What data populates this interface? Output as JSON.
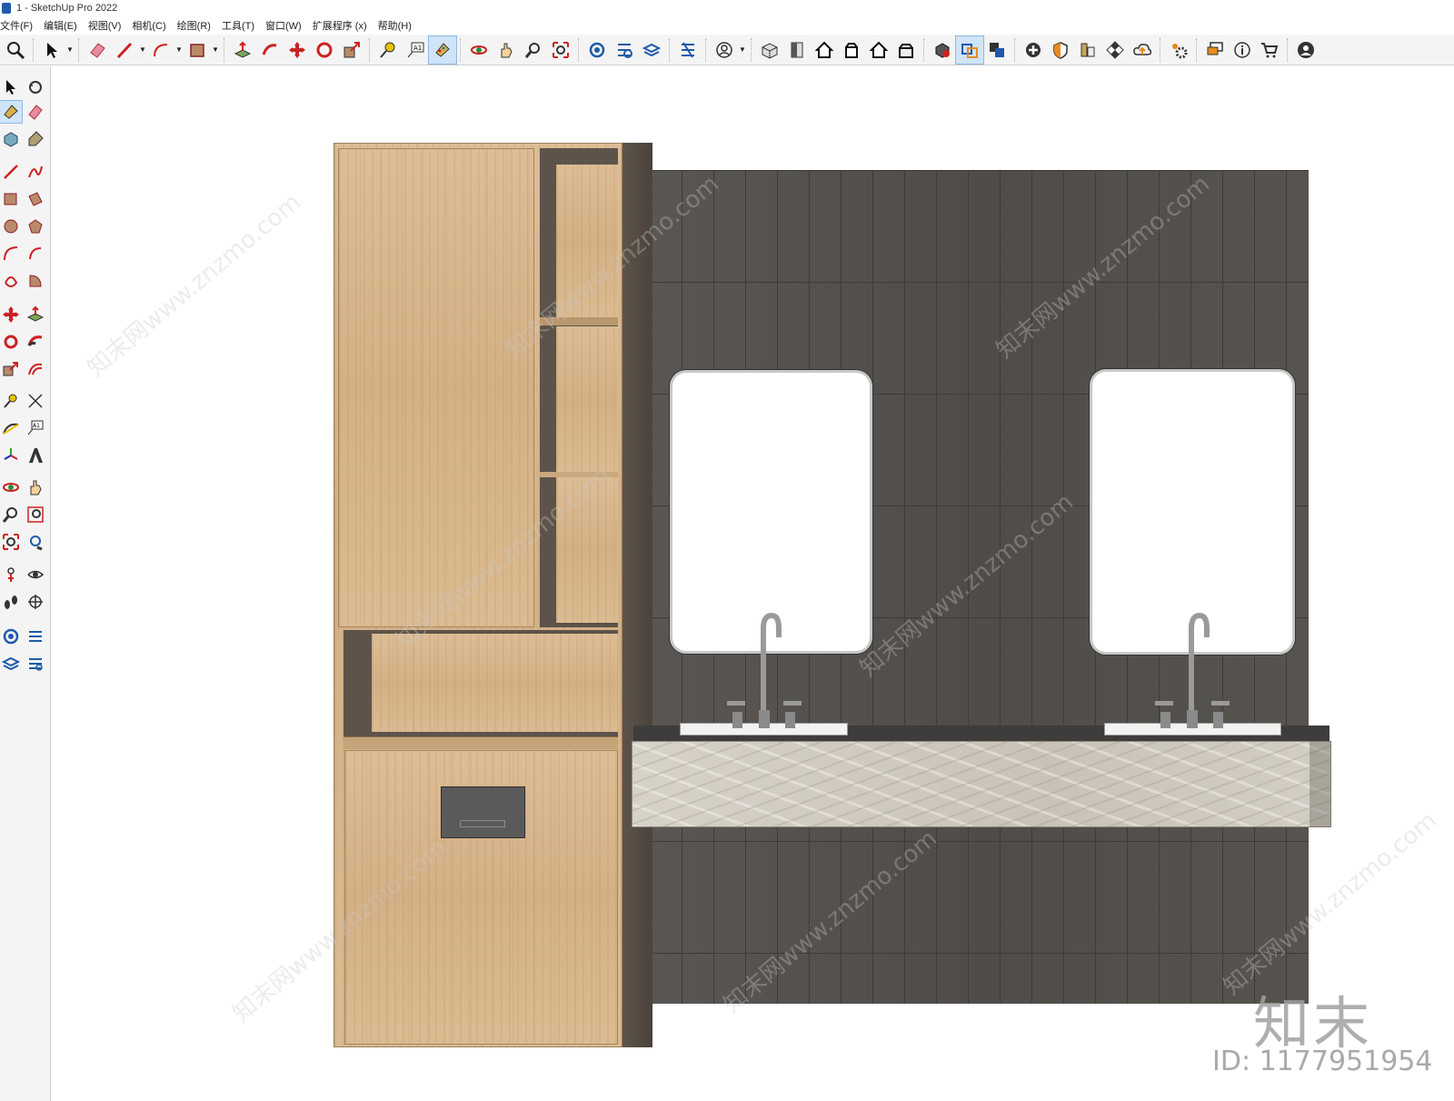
{
  "window": {
    "title": "1 - SketchUp Pro 2022"
  },
  "menu": [
    "文件(F)",
    "编辑(E)",
    "视图(V)",
    "相机(C)",
    "绘图(R)",
    "工具(T)",
    "窗口(W)",
    "扩展程序 (x)",
    "帮助(H)"
  ],
  "toolbar": {
    "icons": [
      "zoom-icon",
      "select-icon",
      "eraser-icon",
      "pencil-icon",
      "arc-icon",
      "rectangle-icon",
      "pushpull-icon",
      "followme-icon",
      "move-icon",
      "rotate-icon",
      "scale-icon",
      "tape-icon",
      "text-icon",
      "paint-icon",
      "orbit-icon",
      "pan-icon",
      "zoom-window-icon",
      "zoom-extents-icon",
      "warehouse-icon",
      "extension-icon",
      "layers-icon",
      "styles-icon",
      "profile-icon",
      "iso-view-icon",
      "top-view-icon",
      "front-view-icon",
      "right-view-icon",
      "back-view-icon",
      "left-view-icon",
      "solid-icon",
      "union-icon",
      "subtract-icon",
      "add-location-icon",
      "shadow-icon",
      "materials-icon",
      "checker-icon",
      "cloud-icon",
      "settings-icon",
      "chat-icon",
      "info-icon",
      "cart-icon",
      "account-icon"
    ],
    "active": "paint-icon"
  },
  "left_toolbar": {
    "icons": [
      "select-icon",
      "orbit-icon",
      "paint-icon",
      "eraser-icon",
      "component-icon",
      "tag-icon",
      "line-icon",
      "freehand-icon",
      "rectangle-icon",
      "rotated-rect-icon",
      "circle-icon",
      "polygon-icon",
      "arc-icon",
      "pie-icon",
      "arc3-icon",
      "pie2-icon",
      "move-icon",
      "pushpull-icon",
      "rotate-icon",
      "followme-icon",
      "scale-icon",
      "offset-icon",
      "tape-icon",
      "dimension-icon",
      "protractor-icon",
      "text-icon",
      "axes-icon",
      "3dtext-icon",
      "orbit2-icon",
      "pan-icon",
      "zoom-icon",
      "zoom-window-icon",
      "zoom-extents-icon",
      "previous-view-icon",
      "position-camera-icon",
      "lookaround-icon",
      "walk-icon",
      "section-icon",
      "warehouse-icon",
      "extension-icon",
      "layers-icon",
      "styles-icon"
    ],
    "active": "paint-icon"
  },
  "watermark": {
    "logo": "知末",
    "id": "ID: 1177951954",
    "diagonal": "知末网www.znzmo.com"
  }
}
